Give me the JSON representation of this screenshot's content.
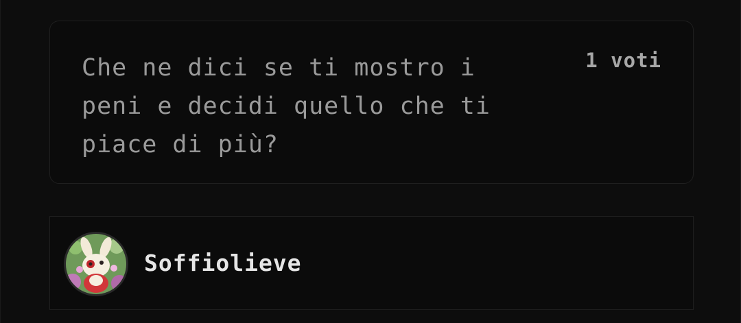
{
  "answer": {
    "text": "Che ne dici se ti mostro i\npeni e decidi quello che ti\npiace di più?",
    "votes": "1 voti"
  },
  "author": {
    "username": "Soffiolieve",
    "avatar_icon": "avatar-bunny-icon"
  },
  "colors": {
    "background": "#0d0d0d",
    "card_border": "#1f1f1f",
    "text_muted": "#9a9a9a",
    "text_strong": "#e6e6e6"
  }
}
